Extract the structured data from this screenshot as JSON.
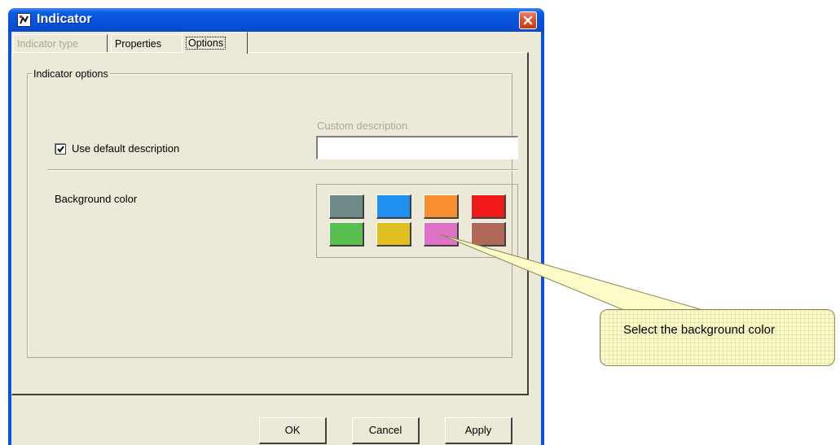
{
  "window": {
    "title": "Indicator",
    "app_icon": "indicator-app-icon",
    "close_icon": "close-icon"
  },
  "tabs": [
    {
      "label": "Indicator type",
      "state": "disabled"
    },
    {
      "label": "Properties",
      "state": "normal"
    },
    {
      "label": "Options",
      "state": "selected"
    }
  ],
  "options": {
    "group_title": "Indicator options",
    "use_default_label": "Use default description",
    "use_default_checked": true,
    "custom_description_label": "Custom description",
    "custom_description_value": "",
    "background_label": "Background color",
    "colors": [
      "#708a8a",
      "#2090f0",
      "#f89030",
      "#f01818",
      "#58c050",
      "#e0c020",
      "#e070c8",
      "#b06858"
    ]
  },
  "buttons": {
    "ok": "OK",
    "cancel": "Cancel",
    "apply": "Apply"
  },
  "callout": {
    "text": "Select the background color"
  }
}
